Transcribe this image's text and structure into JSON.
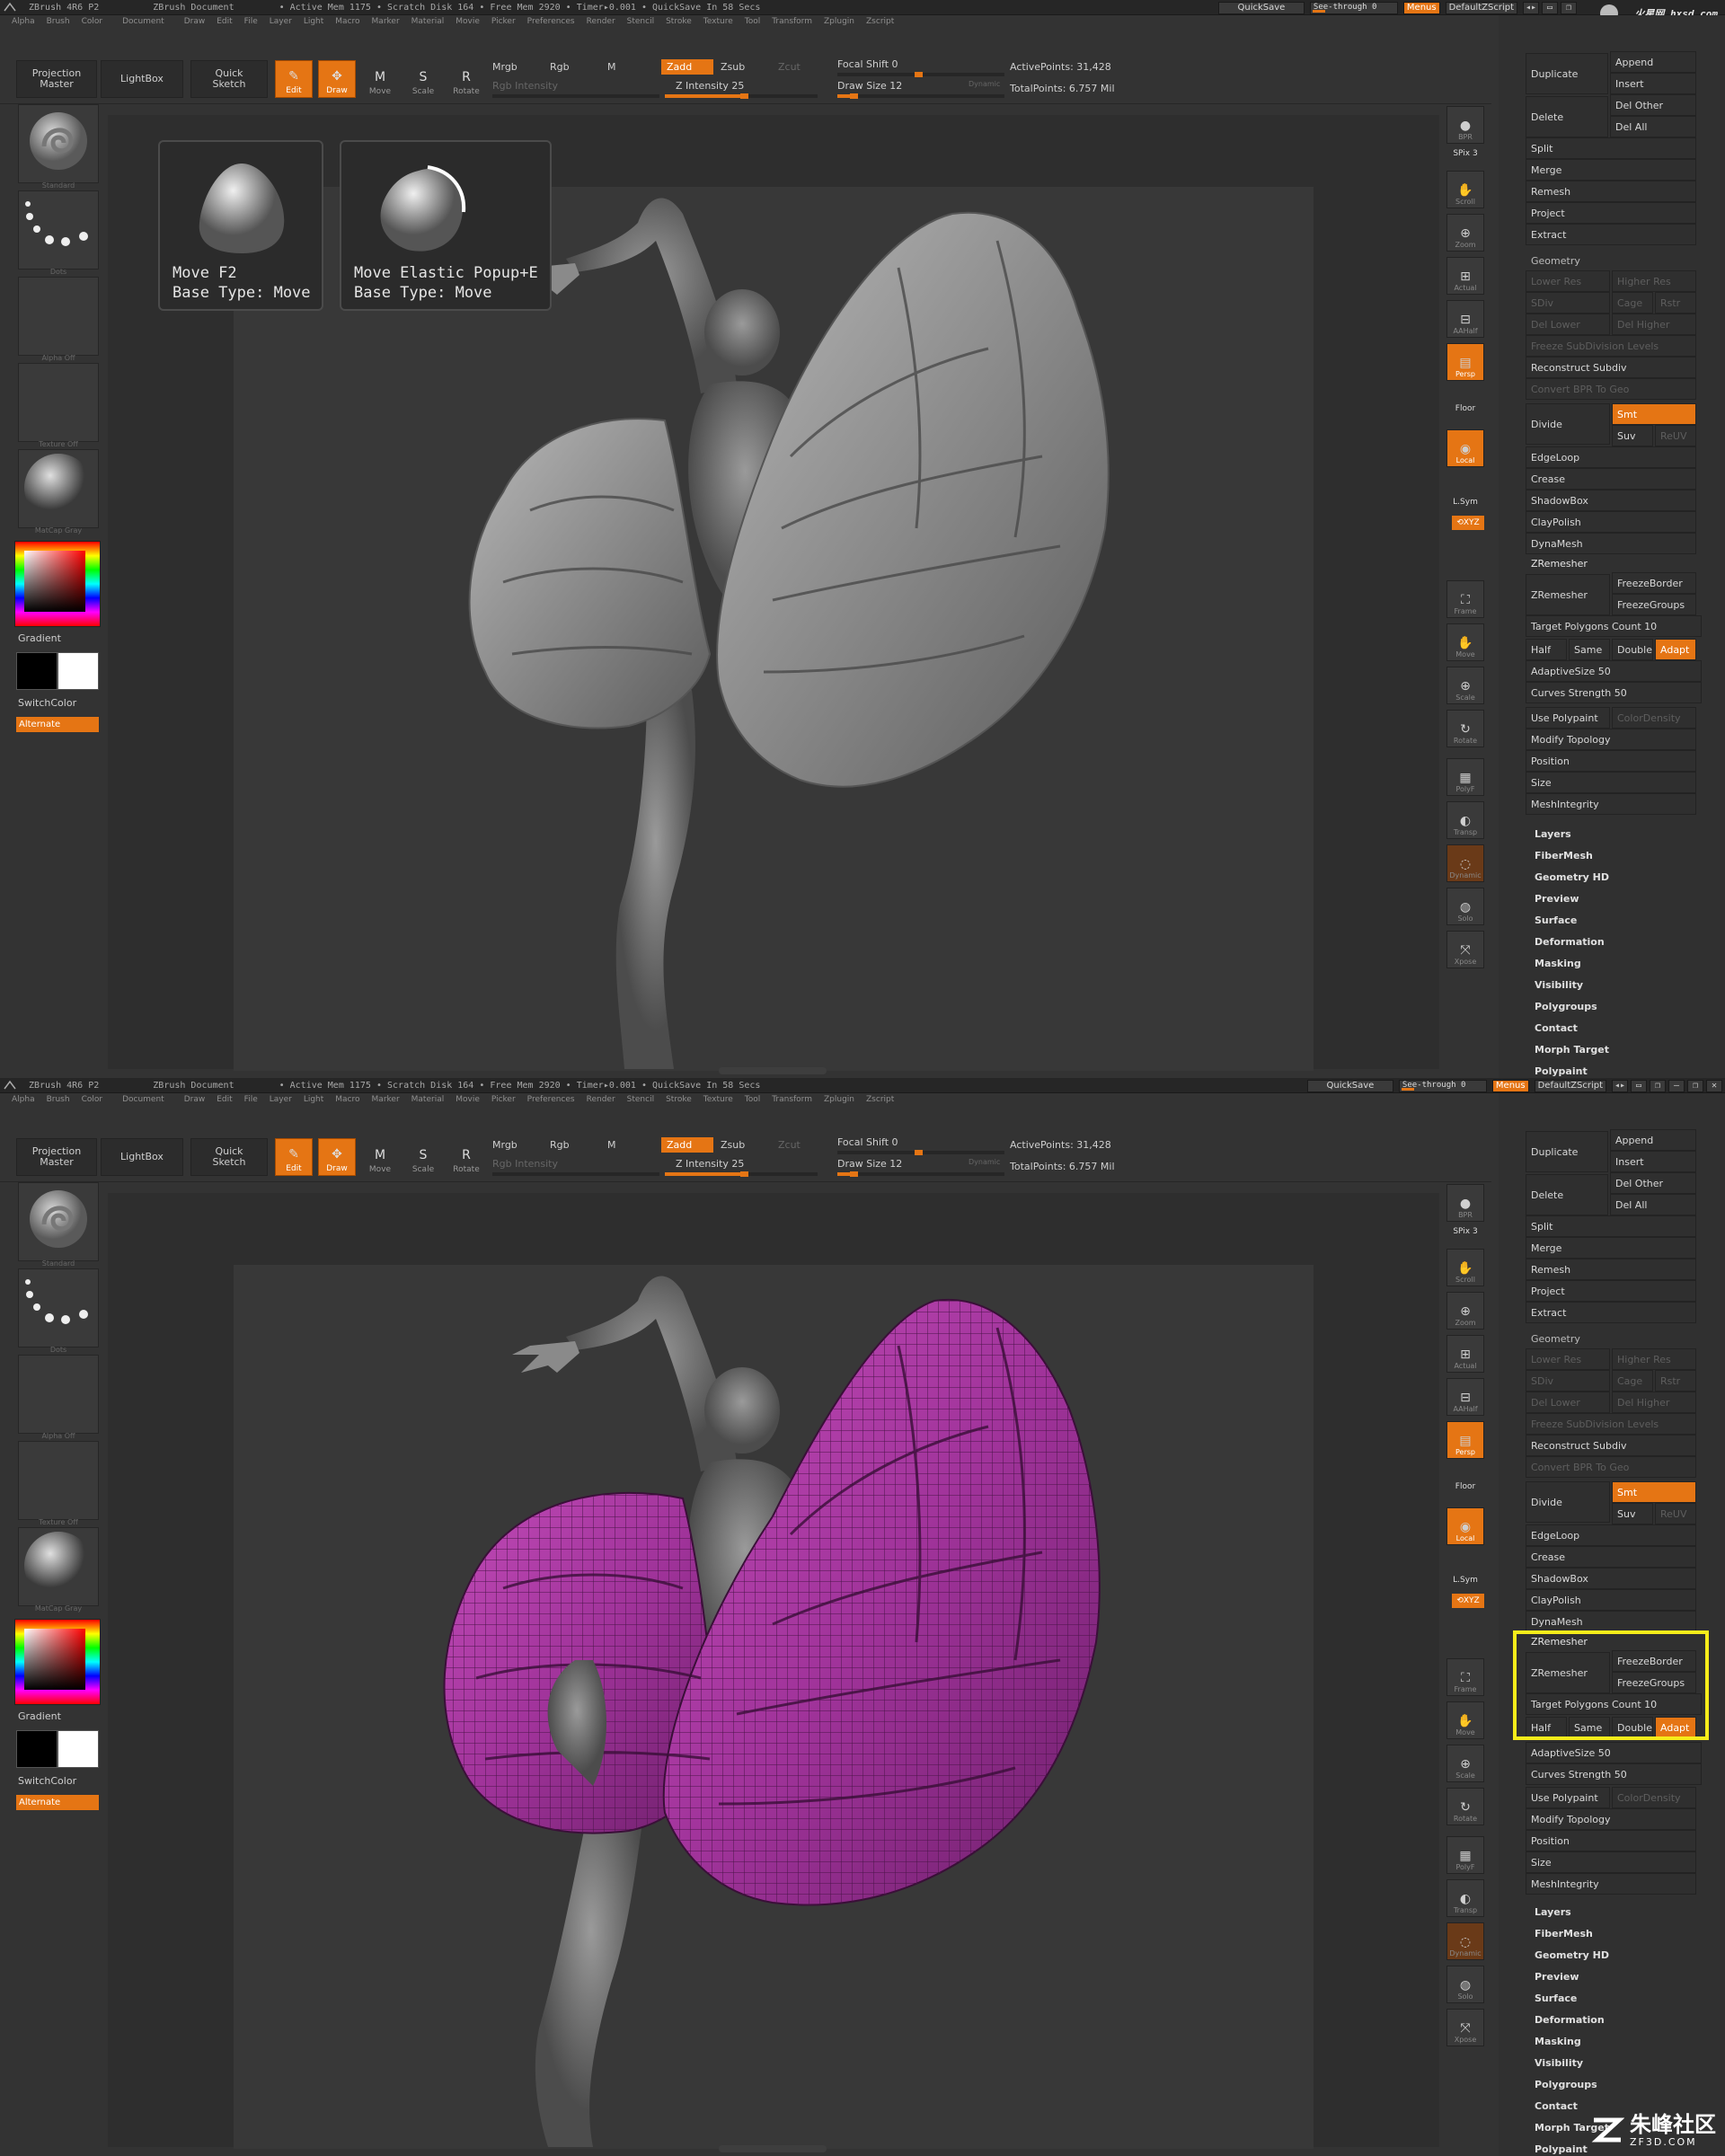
{
  "titlebar": {
    "app": "ZBrush 4R6 P2",
    "doc": "ZBrush Document",
    "stats": "• Active Mem 1175 • Scratch Disk 164 • Free Mem 2920 • Timer▸0.001 • QuickSave In 58 Secs",
    "quicksave": "QuickSave",
    "seethrough": "See-through  0",
    "menus": "Menus",
    "script": "DefaultZScript"
  },
  "watermark_top": "火星网 hxsd.com",
  "menubar": [
    "Alpha",
    "Brush",
    "Color",
    "Document",
    "Draw",
    "Edit",
    "File",
    "Layer",
    "Light",
    "Macro",
    "Marker",
    "Material",
    "Movie",
    "Picker",
    "Preferences",
    "Render",
    "Stencil",
    "Stroke",
    "Texture",
    "Tool",
    "Transform",
    "Zplugin",
    "Zscript"
  ],
  "toolbar": {
    "projection": "Projection\nMaster",
    "lightbox": "LightBox",
    "quicksketch": "Quick\nSketch",
    "tools": [
      {
        "label": "Edit",
        "icon": "edit-icon",
        "glyph": "✎"
      },
      {
        "label": "Draw",
        "icon": "draw-icon",
        "glyph": "✥"
      },
      {
        "label": "Move",
        "icon": "move-icon",
        "glyph": "M"
      },
      {
        "label": "Scale",
        "icon": "scale-icon",
        "glyph": "S"
      },
      {
        "label": "Rotate",
        "icon": "rotate-icon",
        "glyph": "R"
      }
    ],
    "mrgb": "Mrgb",
    "rgb": "Rgb",
    "m": "M",
    "rgb_intensity": "Rgb  Intensity",
    "zadd": "Zadd",
    "zsub": "Zsub",
    "zcut": "Zcut",
    "z_intensity": "Z Intensity 25",
    "focal_shift": "Focal Shift 0",
    "draw_size": "Draw Size 12",
    "dynamic": "Dynamic",
    "active_points": "ActivePoints: 31,428",
    "total_points": "TotalPoints: 6.757 Mil"
  },
  "left_tray": {
    "brush": "Standard",
    "stroke": "Dots",
    "alpha": "Alpha Off",
    "texture": "Texture Off",
    "material": "MatCap Gray",
    "gradient": "Gradient",
    "switchcolor": "SwitchColor",
    "alternate": "Alternate"
  },
  "popups": [
    {
      "title": "Move  F2",
      "sub": "Base Type: Move"
    },
    {
      "title": "Move Elastic  Popup+E",
      "sub": "Base Type: Move"
    }
  ],
  "right_shelf": {
    "bpr": "BPR",
    "spix": "SPix 3",
    "scroll": "Scroll",
    "zoom": "Zoom",
    "actual": "Actual",
    "aahalf": "AAHalf",
    "persp": "Persp",
    "floor": "Floor",
    "local": "Local",
    "lsym": "L.Sym",
    "xyz": "⟲XYZ",
    "frame": "Frame",
    "move": "Move",
    "scale": "Scale",
    "rotate": "Rotate",
    "polyf": "PolyF",
    "transp": "Transp",
    "dynamic": "Dynamic",
    "solo": "Solo",
    "xpose": "Xpose"
  },
  "palette": {
    "duplicate": "Duplicate",
    "append": "Append",
    "insert": "Insert",
    "delete": "Delete",
    "del_other": "Del Other",
    "del_all": "Del All",
    "split": "Split",
    "merge": "Merge",
    "remesh": "Remesh",
    "project": "Project",
    "extract": "Extract",
    "geometry": "Geometry",
    "lower_res": "Lower Res",
    "higher_res": "Higher Res",
    "sdiv": "SDiv",
    "cage": "Cage",
    "rstr": "Rstr",
    "del_lower": "Del Lower",
    "del_higher": "Del Higher",
    "freeze_subdiv": "Freeze SubDivision Levels",
    "reconstruct": "Reconstruct Subdiv",
    "convert_bpr": "Convert BPR To Geo",
    "divide": "Divide",
    "smt": "Smt",
    "suv": "Suv",
    "reluv": "ReUV",
    "edgeloop": "EdgeLoop",
    "crease": "Crease",
    "shadowbox": "ShadowBox",
    "claypolish": "ClayPolish",
    "dynamesh": "DynaMesh",
    "zremesher_head": "ZRemesher",
    "zremesher_btn": "ZRemesher",
    "freezeborder": "FreezeBorder",
    "freezegroups": "FreezeGroups",
    "target_poly": "Target Polygons Count 10",
    "half": "Half",
    "same": "Same",
    "double": "Double",
    "adapt": "Adapt",
    "adaptive_size": "AdaptiveSize 50",
    "curves_strength": "Curves Strength 50",
    "use_polypaint": "Use Polypaint",
    "color_density": "ColorDensity",
    "modify_topology": "Modify Topology",
    "position": "Position",
    "size": "Size",
    "meshintegrity": "MeshIntegrity",
    "menus": [
      "Layers",
      "FiberMesh",
      "Geometry HD",
      "Preview",
      "Surface",
      "Deformation",
      "Masking",
      "Visibility",
      "Polygroups",
      "Contact",
      "Morph Target",
      "Polypaint"
    ]
  },
  "watermark_bottom": {
    "cn": "朱峰社区",
    "en": "ZF3D.COM"
  },
  "colors": {
    "accent": "#e57514",
    "highlight": "#f6ec1a",
    "mesh_purple": "#b03aa8"
  }
}
